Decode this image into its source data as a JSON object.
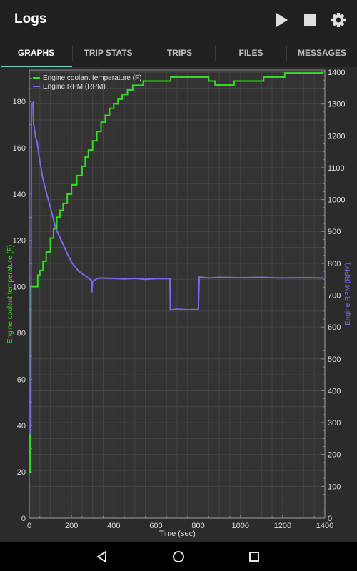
{
  "appbar": {
    "title": "Logs",
    "actions": [
      {
        "name": "play-icon",
        "label": "Start"
      },
      {
        "name": "stop-icon",
        "label": "Stop"
      },
      {
        "name": "gear-icon",
        "label": "Settings"
      }
    ]
  },
  "tabs": [
    {
      "label": "GRAPHS",
      "active": true
    },
    {
      "label": "TRIP STATS",
      "active": false
    },
    {
      "label": "TRIPS",
      "active": false
    },
    {
      "label": "FILES",
      "active": false
    },
    {
      "label": "MESSAGES",
      "active": false
    }
  ],
  "colors": {
    "accent": "#80cbc4",
    "coolant": "#33dd22",
    "rpm": "#7b68ee",
    "grid": "#444444",
    "plot_bg": "#333333"
  },
  "navbar": {
    "buttons": [
      "back-icon",
      "home-icon",
      "recents-icon"
    ]
  },
  "chart_data": {
    "type": "line",
    "title": "",
    "xlabel": "Time (sec)",
    "xlim": [
      0,
      1400
    ],
    "xticks": [
      0,
      200,
      400,
      600,
      800,
      1000,
      1200,
      1400
    ],
    "grid": true,
    "legend_position": "top-left",
    "axes": {
      "left": {
        "label": "Engine coolant temperature (F)",
        "ylim": [
          0,
          193
        ],
        "ticks": [
          0,
          20,
          40,
          60,
          80,
          100,
          120,
          140,
          160,
          180
        ]
      },
      "right": {
        "label": "Engine RPM (RPM)",
        "ylim": [
          0,
          1400
        ],
        "ticks": [
          0,
          100,
          200,
          300,
          400,
          500,
          600,
          700,
          800,
          900,
          1000,
          1100,
          1200,
          1300,
          1400
        ]
      }
    },
    "series": [
      {
        "name": "Engine coolant temperature (F)",
        "axis": "left",
        "step": true,
        "points": [
          [
            0,
            20
          ],
          [
            5,
            36
          ],
          [
            7,
            100
          ],
          [
            35,
            100
          ],
          [
            40,
            105
          ],
          [
            50,
            107
          ],
          [
            65,
            111
          ],
          [
            80,
            115
          ],
          [
            100,
            121
          ],
          [
            115,
            125
          ],
          [
            130,
            130
          ],
          [
            145,
            133
          ],
          [
            160,
            136
          ],
          [
            180,
            140
          ],
          [
            200,
            144
          ],
          [
            225,
            148
          ],
          [
            250,
            152
          ],
          [
            265,
            156
          ],
          [
            280,
            159
          ],
          [
            300,
            163
          ],
          [
            320,
            167
          ],
          [
            340,
            171
          ],
          [
            360,
            174
          ],
          [
            380,
            177
          ],
          [
            400,
            179
          ],
          [
            420,
            181
          ],
          [
            440,
            183
          ],
          [
            465,
            185
          ],
          [
            490,
            187
          ],
          [
            540,
            188.8
          ],
          [
            670,
            188.8
          ],
          [
            670,
            190.5
          ],
          [
            850,
            190.5
          ],
          [
            850,
            188.8
          ],
          [
            880,
            188.8
          ],
          [
            880,
            187.1
          ],
          [
            970,
            187.1
          ],
          [
            970,
            188.8
          ],
          [
            1110,
            188.8
          ],
          [
            1110,
            190.5
          ],
          [
            1210,
            190.5
          ],
          [
            1210,
            192.3
          ],
          [
            1390,
            192.3
          ]
        ]
      },
      {
        "name": "Engine RPM (RPM)",
        "axis": "right",
        "step": false,
        "points": [
          [
            7,
            264
          ],
          [
            10,
            1300
          ],
          [
            17,
            1304
          ],
          [
            20,
            1240
          ],
          [
            27,
            1210
          ],
          [
            30,
            1195
          ],
          [
            37,
            1182
          ],
          [
            47,
            1133
          ],
          [
            64,
            1066
          ],
          [
            81,
            1021
          ],
          [
            98,
            981
          ],
          [
            125,
            910
          ],
          [
            162,
            857
          ],
          [
            183,
            826
          ],
          [
            203,
            801
          ],
          [
            234,
            775
          ],
          [
            267,
            760
          ],
          [
            294,
            747
          ],
          [
            296,
            709
          ],
          [
            300,
            743
          ],
          [
            320,
            752
          ],
          [
            335,
            754
          ],
          [
            400,
            753
          ],
          [
            450,
            751
          ],
          [
            500,
            753
          ],
          [
            550,
            750
          ],
          [
            600,
            752
          ],
          [
            666,
            752
          ],
          [
            668,
            653
          ],
          [
            700,
            656
          ],
          [
            750,
            654
          ],
          [
            801,
            655
          ],
          [
            805,
            757
          ],
          [
            850,
            754
          ],
          [
            900,
            756
          ],
          [
            1000,
            755
          ],
          [
            1100,
            756
          ],
          [
            1200,
            754
          ],
          [
            1300,
            755
          ],
          [
            1390,
            754
          ]
        ]
      }
    ]
  }
}
